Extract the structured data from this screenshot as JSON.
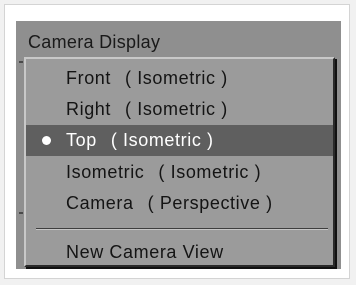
{
  "menu": {
    "title": "Camera Display",
    "items": [
      {
        "name": "Front",
        "mode": "( Isometric )",
        "selected": false
      },
      {
        "name": "Right",
        "mode": "( Isometric )",
        "selected": false
      },
      {
        "name": "Top",
        "mode": "( Isometric )",
        "selected": true
      },
      {
        "name": "Isometric",
        "mode": "( Isometric )",
        "selected": false
      },
      {
        "name": "Camera",
        "mode": "( Perspective )",
        "selected": false
      }
    ],
    "new_view_label": "New Camera View"
  },
  "icons": {
    "selected_marker": "bullet-icon"
  },
  "colors": {
    "panel_bg": "#8f8f8f",
    "menu_bg": "#9b9b9b",
    "highlight_bg": "#5f5f5f",
    "highlight_text": "#ffffff",
    "text": "#141414"
  }
}
